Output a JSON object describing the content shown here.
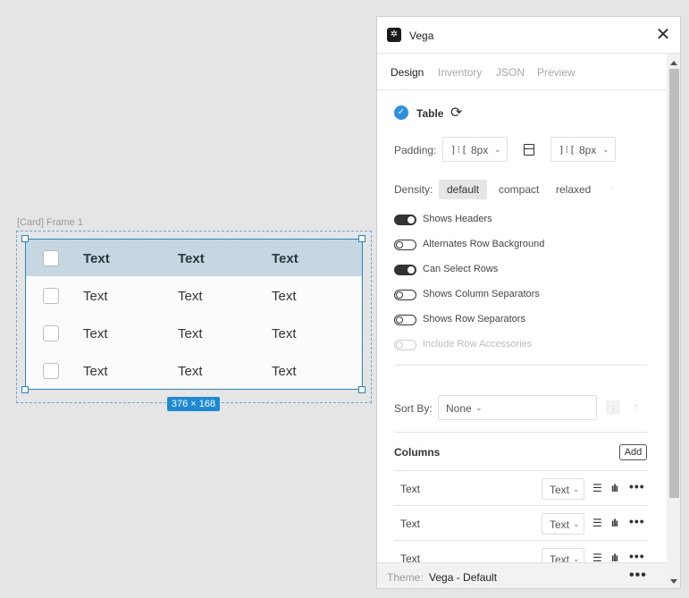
{
  "canvas": {
    "frame_label": "[Card] Frame 1",
    "dimensions_badge": "376 × 168",
    "table": {
      "headers": [
        "Text",
        "Text",
        "Text"
      ],
      "rows": [
        [
          "Text",
          "Text",
          "Text"
        ],
        [
          "Text",
          "Text",
          "Text"
        ],
        [
          "Text",
          "Text",
          "Text"
        ]
      ]
    }
  },
  "panel": {
    "title": "Vega",
    "tabs": [
      {
        "label": "Design",
        "active": true
      },
      {
        "label": "Inventory",
        "active": false
      },
      {
        "label": "JSON",
        "active": false
      },
      {
        "label": "Preview",
        "active": false
      }
    ],
    "component": {
      "name": "Table"
    },
    "padding": {
      "label": "Padding:",
      "horizontal": "8px",
      "vertical": "8px"
    },
    "density": {
      "label": "Density:",
      "options": [
        "default",
        "compact",
        "relaxed"
      ],
      "selected": "default",
      "extra": "-"
    },
    "toggles": [
      {
        "label": "Shows Headers",
        "on": true,
        "disabled": false
      },
      {
        "label": "Alternates Row Background",
        "on": false,
        "disabled": false
      },
      {
        "label": "Can Select Rows",
        "on": true,
        "disabled": false
      },
      {
        "label": "Shows Column Separators",
        "on": false,
        "disabled": false
      },
      {
        "label": "Shows Row Separators",
        "on": false,
        "disabled": false
      },
      {
        "label": "Include Row Accessories",
        "on": false,
        "disabled": true
      }
    ],
    "sort": {
      "label": "Sort By:",
      "value": "None"
    },
    "columns": {
      "title": "Columns",
      "add_label": "Add",
      "items": [
        {
          "name": "Text",
          "type": "Text"
        },
        {
          "name": "Text",
          "type": "Text"
        },
        {
          "name": "Text",
          "type": "Text"
        }
      ]
    },
    "footer": {
      "label": "Theme:",
      "value": "Vega - Default"
    }
  },
  "colors": {
    "selection": "#1e8ad6",
    "table_header": "#c6d7e1",
    "check_badge": "#2d8fe0"
  }
}
